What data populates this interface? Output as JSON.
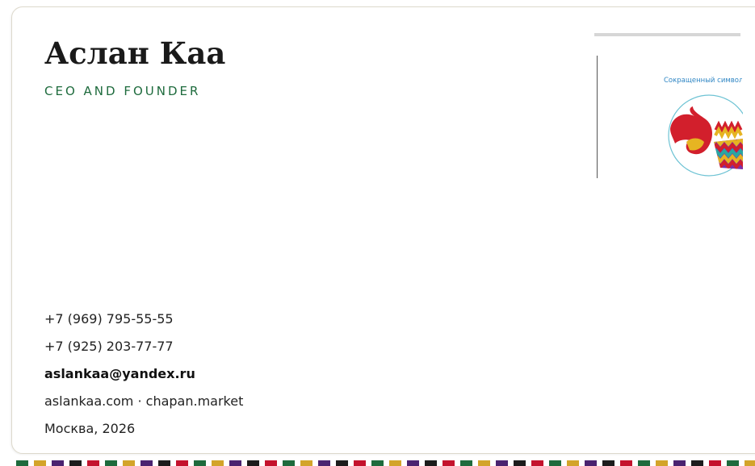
{
  "card": {
    "name": "Аслан Каа",
    "role": "CEO AND FOUNDER"
  },
  "mark": {
    "caption": "Сокращенный символ",
    "icon": "chapan-flame-pattern-logo",
    "colors": {
      "ring": "#6ec3d4",
      "flame": "#d21f2c",
      "zigzag": [
        "#e6b422",
        "#7d2fa6",
        "#2aa7a1",
        "#d21f2c",
        "#1c1c1c"
      ]
    }
  },
  "contacts": {
    "phone_1": "+7 (969) 795-55-55",
    "phone_2": "+7 (925) 203-77-77",
    "email": "aslankaa@yandex.ru",
    "websites": "aslankaa.com · chapan.market",
    "city_year": "Москва, 2026"
  },
  "colors": {
    "accent_green": "#1e6b3d",
    "stripe_palette": [
      "#1e6b3d",
      "#d3a42a",
      "#4a2370",
      "#1c1c1c",
      "#c4122d"
    ]
  }
}
